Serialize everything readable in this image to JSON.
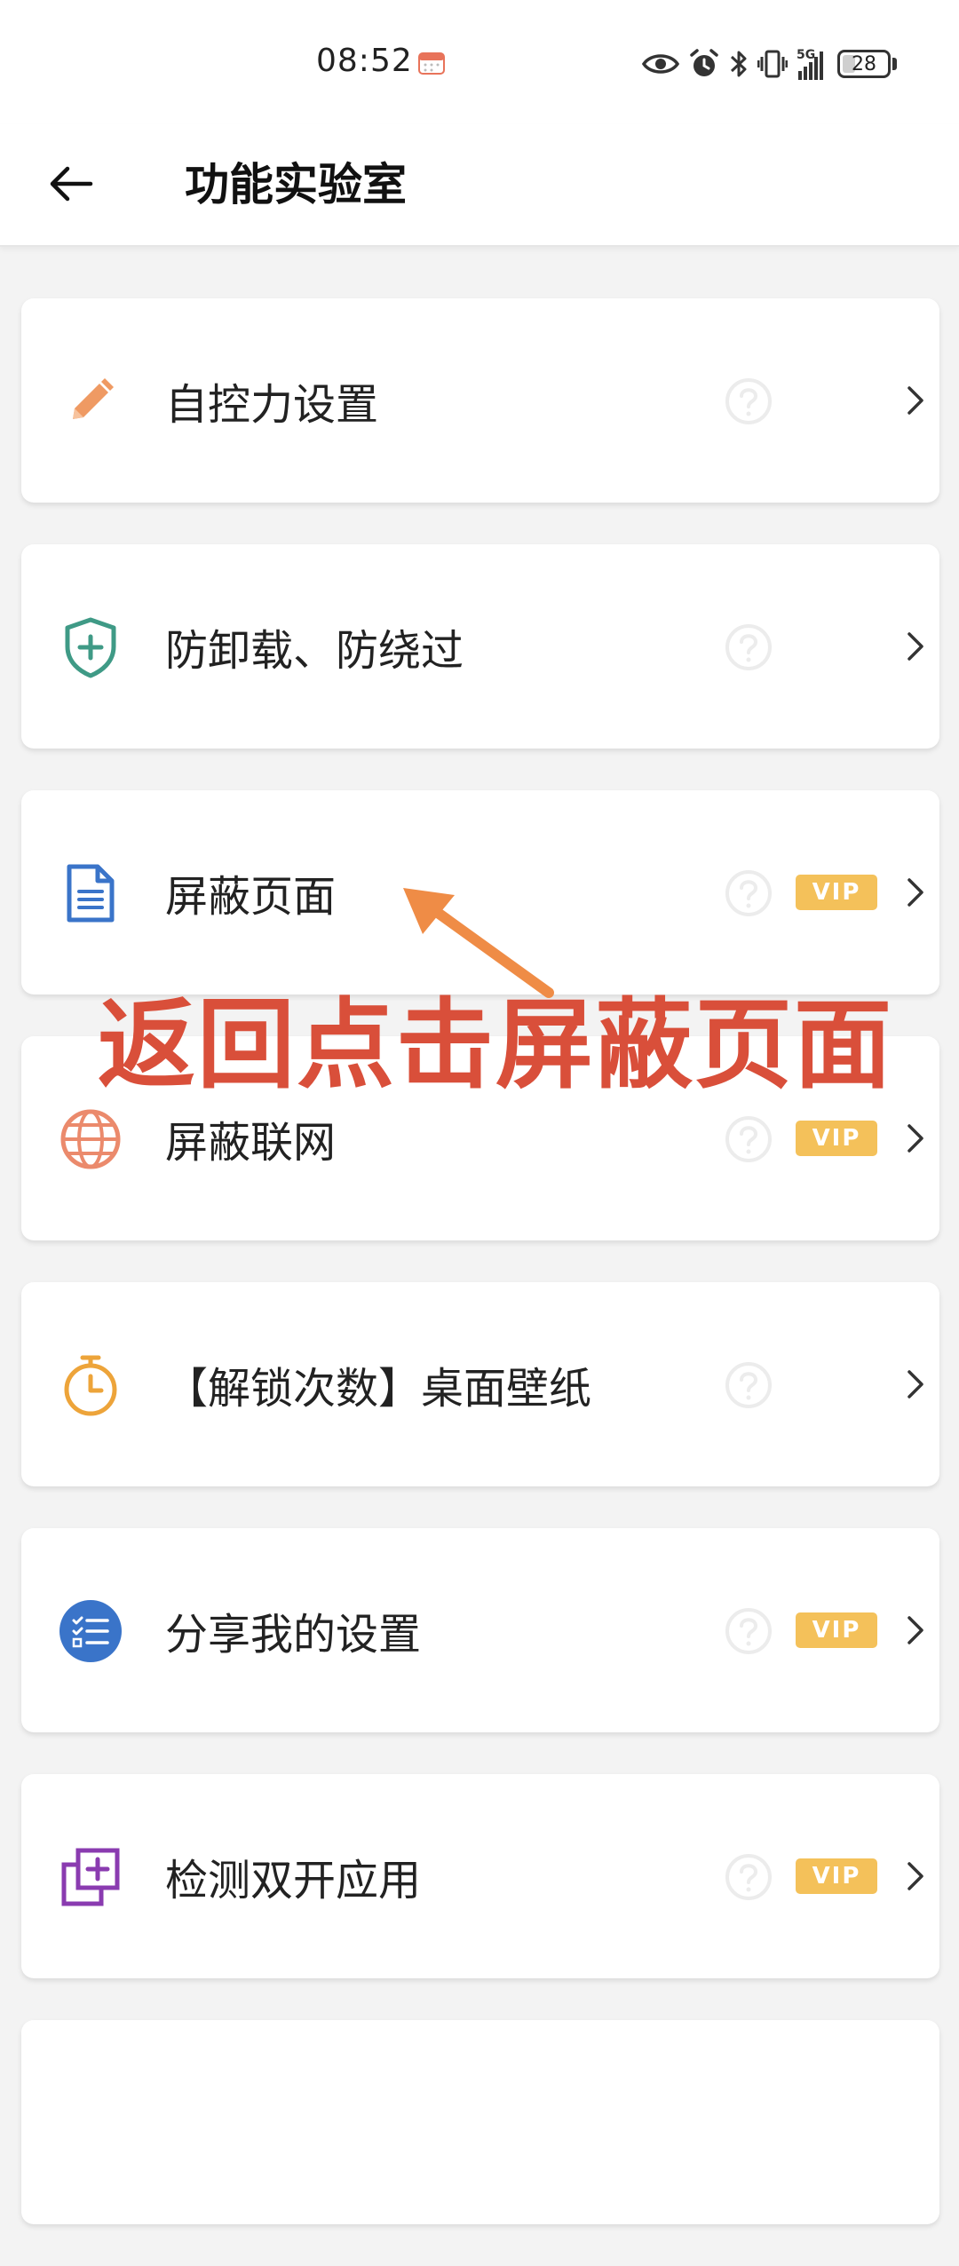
{
  "status_bar": {
    "time": "08:52",
    "network": "5G",
    "battery": "28",
    "icons": [
      "calendar-icon",
      "eye-icon",
      "alarm-icon",
      "bluetooth-icon",
      "vibrate-icon",
      "signal-icon",
      "battery-icon"
    ]
  },
  "header": {
    "title": "功能实验室",
    "back_icon": "arrow-left-icon"
  },
  "items": [
    {
      "label": "自控力设置",
      "icon": "pencil-icon",
      "vip": false
    },
    {
      "label": "防卸载、防绕过",
      "icon": "shield-plus-icon",
      "vip": false
    },
    {
      "label": "屏蔽页面",
      "icon": "document-icon",
      "vip": true
    },
    {
      "label": "屏蔽联网",
      "icon": "globe-icon",
      "vip": true
    },
    {
      "label": "【解锁次数】桌面壁纸",
      "icon": "stopwatch-icon",
      "vip": false
    },
    {
      "label": "分享我的设置",
      "icon": "checklist-icon",
      "vip": true
    },
    {
      "label": "检测双开应用",
      "icon": "dual-app-icon",
      "vip": true
    }
  ],
  "vip_label": "VIP",
  "annotation": "返回点击屏蔽页面",
  "colors": {
    "vip": "#f4c15a",
    "annotation": "#d94f3a",
    "arrow": "#ef8c46"
  }
}
